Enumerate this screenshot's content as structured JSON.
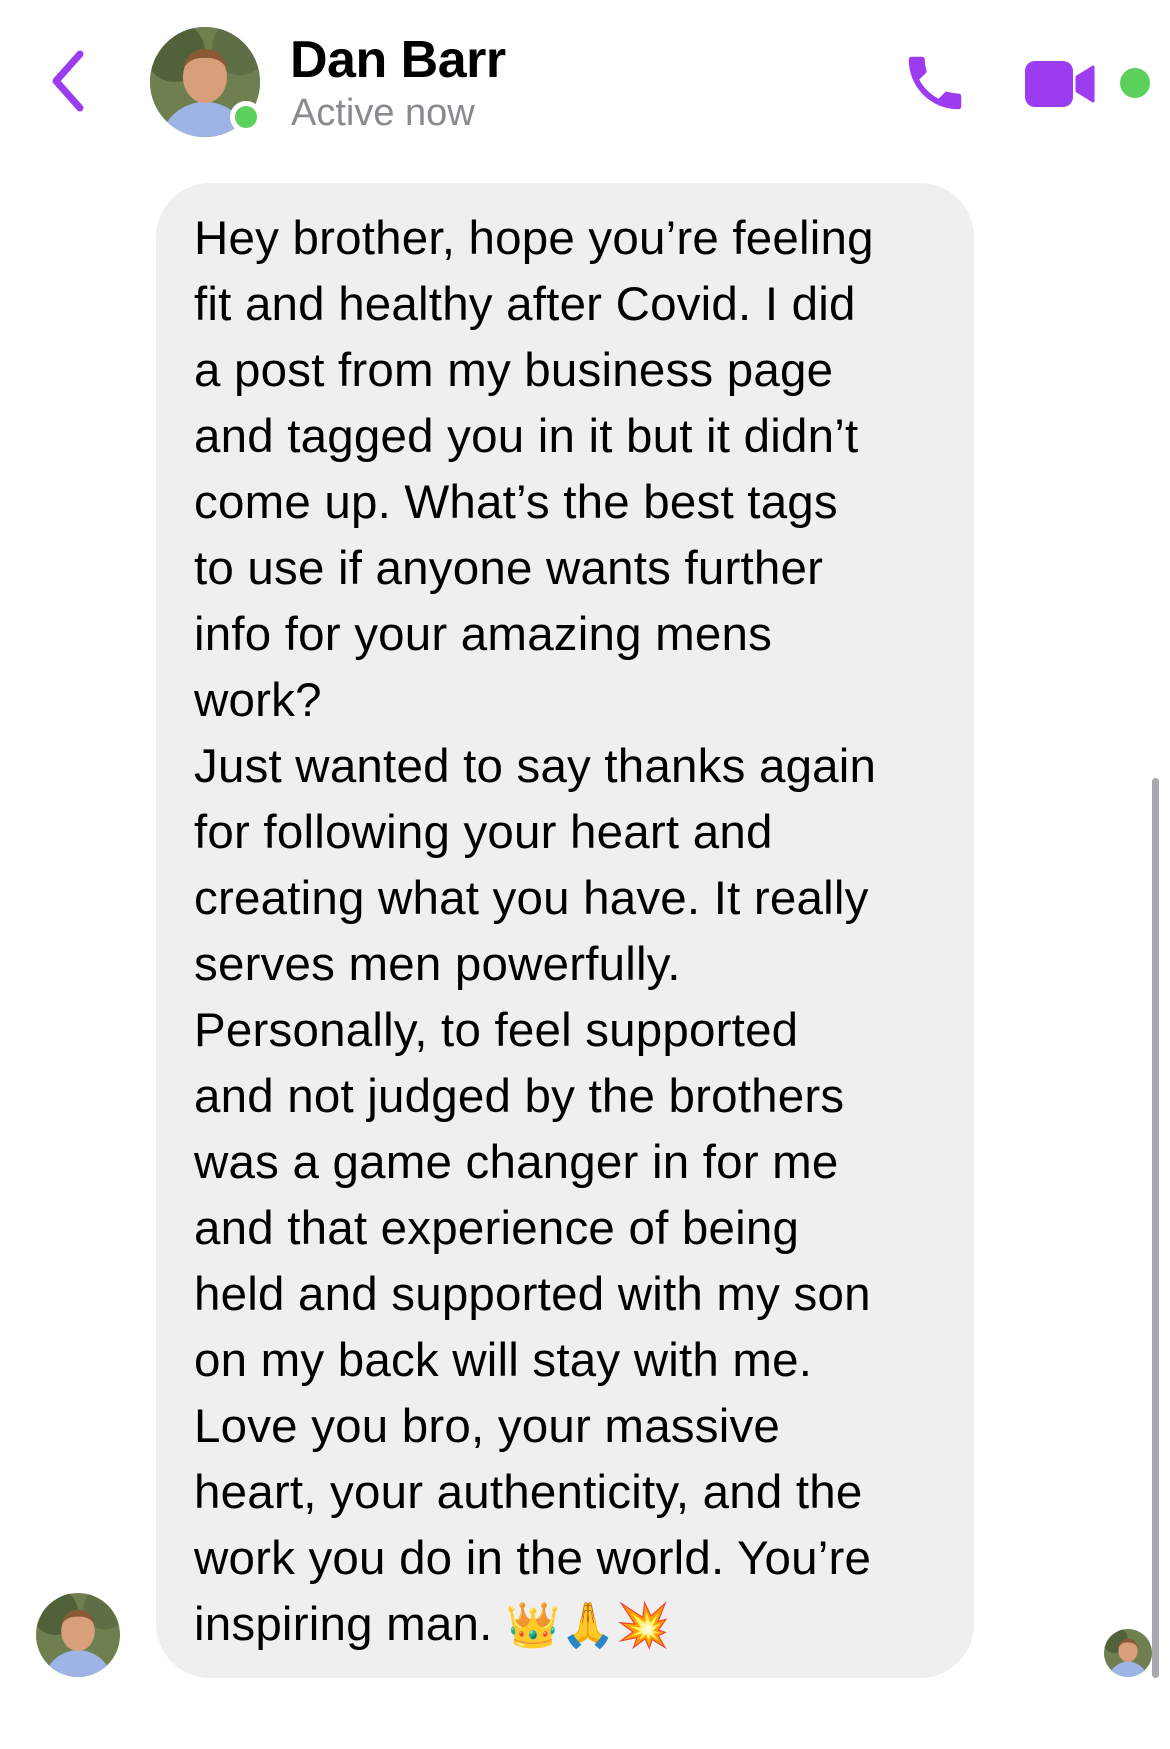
{
  "header": {
    "contact_name": "Dan Barr",
    "status": "Active now"
  },
  "icons": {
    "back": "chevron-left-icon",
    "call": "phone-icon",
    "video": "video-camera-icon"
  },
  "colors": {
    "accent": "#9b3cf1",
    "online": "#5bd05b",
    "bubble": "#efeff0",
    "status_text": "#8a8a8e"
  },
  "message": {
    "lines": [
      "Hey brother, hope you’re feeling",
      "fit and healthy after Covid. I did",
      "a post from my business page",
      "and tagged you in it but it didn’t",
      "come up. What’s the best tags",
      "to use if anyone wants further",
      "info for your amazing mens",
      "work?",
      "Just wanted to say thanks again",
      "for following your heart and",
      "creating what you have. It really",
      "serves men powerfully.",
      "Personally, to feel supported",
      "and not judged by the brothers",
      "was a game changer in for me",
      "and that experience of being",
      "held and supported with my son",
      "on my back will stay with me.",
      "Love you bro, your massive",
      "heart, your authenticity, and the",
      "work you do in the world. You’re"
    ],
    "last_line": "inspiring man.",
    "emojis": [
      "👑",
      "🙏",
      "💥"
    ]
  }
}
